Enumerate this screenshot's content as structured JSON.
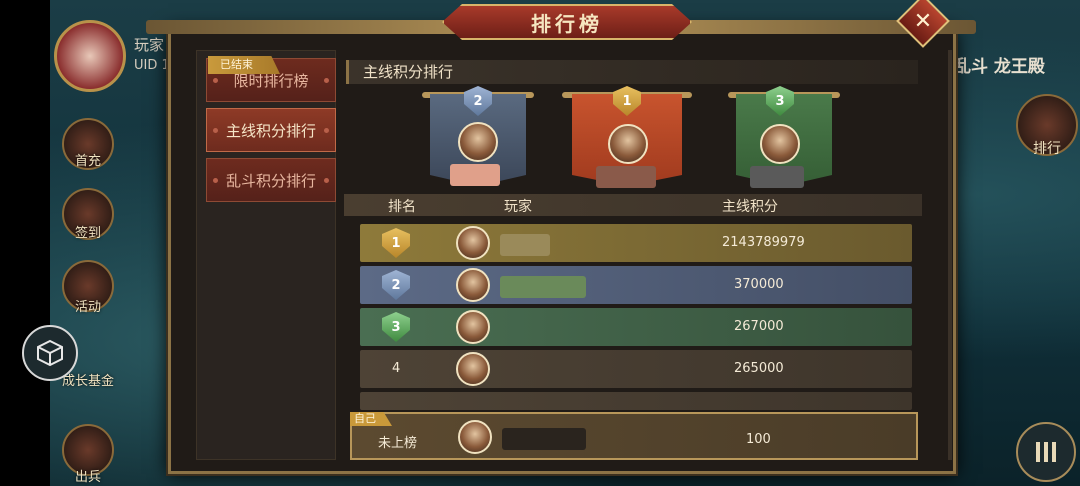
{
  "background": {
    "player_label": "玩家",
    "uid_label": "UID 1",
    "right_title": "乱斗 龙王殿",
    "right_rank_label": "排行",
    "menu_icon": "menu-icon",
    "left_buttons": [
      {
        "label": "首充",
        "icon": "first-charge-icon"
      },
      {
        "label": "签到",
        "icon": "checkin-icon"
      },
      {
        "label": "活动",
        "icon": "activity-icon"
      },
      {
        "label": "成长基金",
        "icon": "growth-fund-icon"
      },
      {
        "label": "出兵",
        "icon": "dispatch-icon"
      }
    ]
  },
  "dialog": {
    "title": "排行榜",
    "close_icon": "close-icon"
  },
  "tabs": [
    {
      "label": "限时排行榜",
      "badge": "已结束",
      "active": false
    },
    {
      "label": "主线积分排行",
      "active": true
    },
    {
      "label": "乱斗积分排行",
      "active": false
    }
  ],
  "content": {
    "title": "主线积分排行",
    "podium": [
      {
        "rank": "2",
        "color": "silver"
      },
      {
        "rank": "1",
        "color": "gold"
      },
      {
        "rank": "3",
        "color": "green"
      }
    ],
    "table": {
      "headers": [
        "排名",
        "玩家",
        "主线积分"
      ],
      "rows": [
        {
          "rank": "1",
          "score": "2143789979"
        },
        {
          "rank": "2",
          "score": "370000"
        },
        {
          "rank": "3",
          "score": "267000"
        },
        {
          "rank": "4",
          "score": "265000"
        }
      ]
    },
    "self": {
      "tag": "自己",
      "rank": "未上榜",
      "score": "100"
    }
  },
  "colors": {
    "gold": "#e8c060",
    "silver": "#9fb4d4",
    "green": "#8ed08e",
    "accent_border": "#b8975a"
  }
}
